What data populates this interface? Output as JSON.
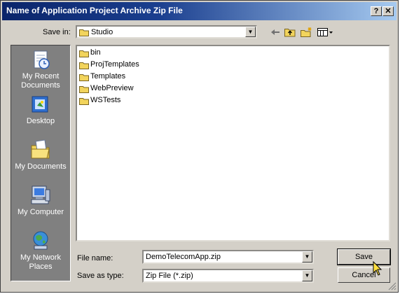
{
  "window": {
    "title": "Name of Application Project Archive Zip File",
    "help_glyph": "?",
    "close_glyph": "✕"
  },
  "save_in": {
    "label": "Save in:",
    "value": "Studio"
  },
  "toolbar": {
    "icons": [
      "back-icon",
      "up-folder-icon",
      "new-folder-icon",
      "view-menu-icon"
    ]
  },
  "places": [
    {
      "label": "My Recent Documents",
      "icon": "recent-documents-icon"
    },
    {
      "label": "Desktop",
      "icon": "desktop-icon"
    },
    {
      "label": "My Documents",
      "icon": "my-documents-icon"
    },
    {
      "label": "My Computer",
      "icon": "my-computer-icon"
    },
    {
      "label": "My Network Places",
      "icon": "network-places-icon"
    }
  ],
  "files": [
    {
      "name": "bin"
    },
    {
      "name": "ProjTemplates"
    },
    {
      "name": "Templates"
    },
    {
      "name": "WebPreview"
    },
    {
      "name": "WSTests"
    }
  ],
  "file_name": {
    "label": "File name:",
    "value": "DemoTelecomApp.zip"
  },
  "save_as_type": {
    "label": "Save as type:",
    "value": "Zip File (*.zip)"
  },
  "buttons": {
    "save": "Save",
    "cancel": "Cancel"
  },
  "colors": {
    "title_bar_start": "#0a246a",
    "title_bar_end": "#a6caf0",
    "dialog_face": "#d4d0c8",
    "places_bar": "#808080",
    "folder": "#f2d45c"
  }
}
